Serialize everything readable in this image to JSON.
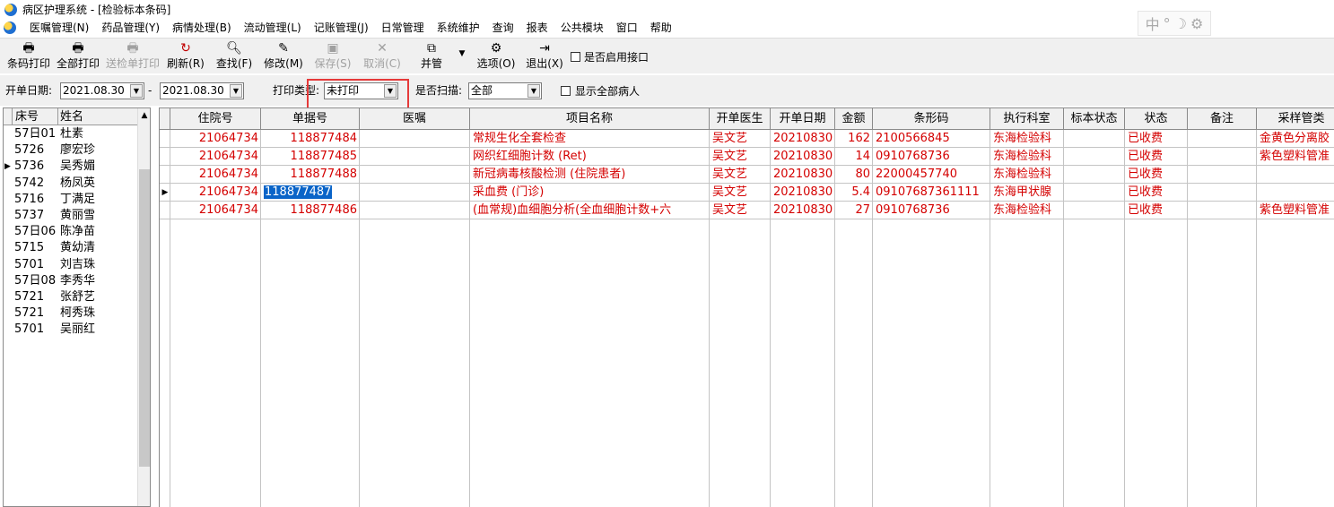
{
  "window": {
    "title": "病区护理系统 - [检验标本条码]"
  },
  "menu": [
    "医嘱管理(N)",
    "药品管理(Y)",
    "病情处理(B)",
    "流动管理(L)",
    "记账管理(J)",
    "日常管理",
    "系统维护",
    "查询",
    "报表",
    "公共模块",
    "窗口",
    "帮助"
  ],
  "ime": {
    "lang": "中"
  },
  "toolbar": {
    "barcode_print": "条码打印",
    "print_all": "全部打印",
    "send_print": "送检单打印",
    "refresh": "刷新(R)",
    "find": "查找(F)",
    "modify": "修改(M)",
    "save": "保存(S)",
    "cancel": "取消(C)",
    "merge": "并管",
    "options": "选项(O)",
    "exit": "退出(X)",
    "enable_interface": "是否启用接口"
  },
  "filter": {
    "date_label": "开单日期:",
    "date_from": "2021.08.30",
    "date_sep": "-",
    "date_to": "2021.08.30",
    "print_type_label": "打印类型:",
    "print_type_value": "未打印",
    "scan_label": "是否扫描:",
    "scan_value": "全部",
    "show_all": "显示全部病人"
  },
  "patients": {
    "headers": {
      "bed": "床号",
      "name": "姓名"
    },
    "rows": [
      {
        "bed": "57日01",
        "name": "杜素",
        "current": false
      },
      {
        "bed": "5726",
        "name": "廖宏珍",
        "current": false
      },
      {
        "bed": "5736",
        "name": "吴秀媚",
        "current": true
      },
      {
        "bed": "5742",
        "name": "杨凤英",
        "current": false
      },
      {
        "bed": "5716",
        "name": "丁满足",
        "current": false
      },
      {
        "bed": "5737",
        "name": "黄丽雪",
        "current": false
      },
      {
        "bed": "57日06",
        "name": "陈净苗",
        "current": false
      },
      {
        "bed": "5715",
        "name": "黄幼清",
        "current": false
      },
      {
        "bed": "5701",
        "name": "刘吉珠",
        "current": false
      },
      {
        "bed": "57日08",
        "name": "李秀华",
        "current": false
      },
      {
        "bed": "5721",
        "name": "张舒艺",
        "current": false
      },
      {
        "bed": "5721",
        "name": "柯秀珠",
        "current": false
      },
      {
        "bed": "5701",
        "name": "吴丽红",
        "current": false
      }
    ]
  },
  "grid": {
    "headers": [
      "住院号",
      "单据号",
      "医嘱",
      "项目名称",
      "开单医生",
      "开单日期",
      "金额",
      "条形码",
      "执行科室",
      "标本状态",
      "状态",
      "备注",
      "采样管类"
    ],
    "rows": [
      {
        "admission": "21064734",
        "doc_no": "118877484",
        "order": "",
        "item": "常规生化全套检查",
        "doctor": "吴文艺",
        "date": "20210830",
        "amount": "162",
        "barcode": "2100566845",
        "dept": "东海检验科",
        "specimen": "",
        "status": "已收费",
        "note": "",
        "tube": "金黄色分离胶",
        "current": false
      },
      {
        "admission": "21064734",
        "doc_no": "118877485",
        "order": "",
        "item": "网织红细胞计数 (Ret)",
        "doctor": "吴文艺",
        "date": "20210830",
        "amount": "14",
        "barcode": "0910768736",
        "dept": "东海检验科",
        "specimen": "",
        "status": "已收费",
        "note": "",
        "tube": "紫色塑料管准",
        "current": false
      },
      {
        "admission": "21064734",
        "doc_no": "118877488",
        "order": "",
        "item": "新冠病毒核酸检测 (住院患者)",
        "doctor": "吴文艺",
        "date": "20210830",
        "amount": "80",
        "barcode": "22000457740",
        "dept": "东海检验科",
        "specimen": "",
        "status": "已收费",
        "note": "",
        "tube": "",
        "current": false
      },
      {
        "admission": "21064734",
        "doc_no": "118877487",
        "order": "",
        "item": "采血费 (门诊)",
        "doctor": "吴文艺",
        "date": "20210830",
        "amount": "5.4",
        "barcode": "09107687361111",
        "dept": "东海甲状腺",
        "specimen": "",
        "status": "已收费",
        "note": "",
        "tube": "",
        "current": true
      },
      {
        "admission": "21064734",
        "doc_no": "118877486",
        "order": "",
        "item": "(血常规)血细胞分析(全血细胞计数+六",
        "doctor": "吴文艺",
        "date": "20210830",
        "amount": "27",
        "barcode": "0910768736",
        "dept": "东海检验科",
        "specimen": "",
        "status": "已收费",
        "note": "",
        "tube": "紫色塑料管准",
        "current": false
      }
    ]
  }
}
